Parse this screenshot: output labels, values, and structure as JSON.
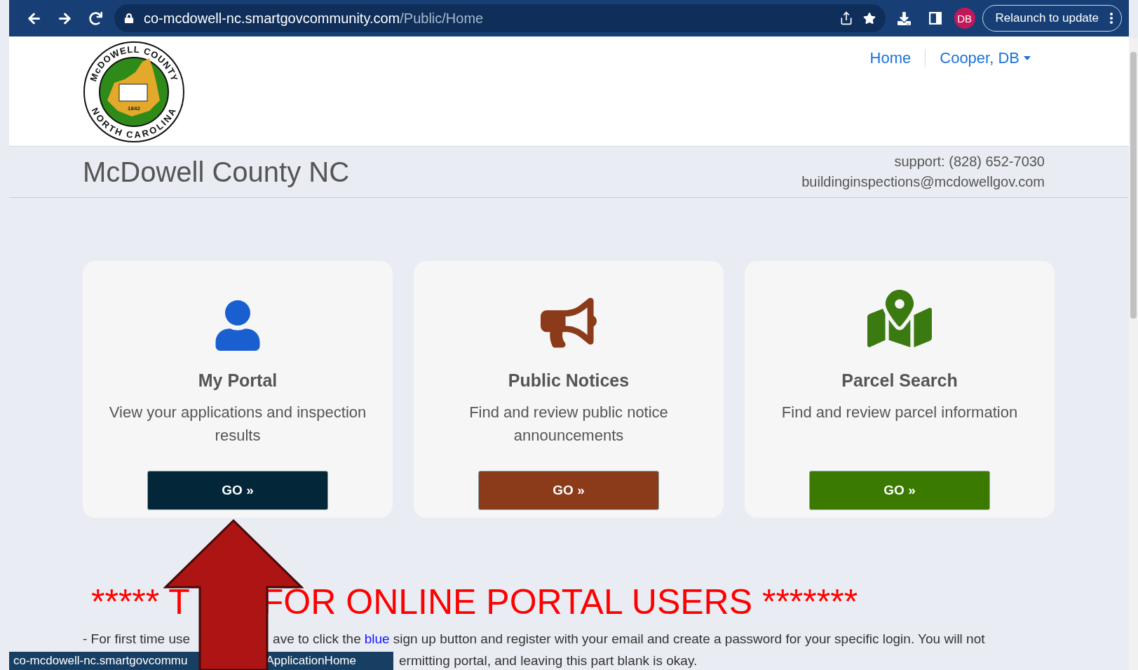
{
  "browser": {
    "url_host": "co-mcdowell-nc.smartgovcommunity.com",
    "url_path": "/Public/Home",
    "profile": "DB",
    "update_button": "Relaunch to update"
  },
  "logo": {
    "top": "McDOWELL COUNTY",
    "bottom": "NORTH CAROLINA",
    "year": "1842"
  },
  "nav": [
    {
      "label": "Home",
      "dropdown": false
    },
    {
      "label": "Cooper, DB",
      "dropdown": true
    }
  ],
  "site_title": "McDowell County NC",
  "support": [
    "support: (828) 652-7030",
    "buildinginspections@mcdowellgov.com"
  ],
  "cards": [
    {
      "kind": "person",
      "title": "My Portal",
      "description": "View your applications and inspection results",
      "button": "GO »",
      "color": "#032639"
    },
    {
      "kind": "megaphone",
      "title": "Public Notices",
      "description": "Find and review public notice announcements",
      "button": "GO »",
      "color": "#8b3a1a"
    },
    {
      "kind": "map",
      "title": "Parcel Search",
      "description": "Find and review parcel information",
      "button": "GO »",
      "color": "#3a7a00"
    }
  ],
  "notice": {
    "heading_left": "***** T",
    "heading_right": "FOR ONLINE PORTAL USERS *******",
    "line1_left": "- For first time use",
    "line1_before": "ave to click the",
    "line1_link": "blue",
    "line1_after": "sign up button and register with your email and create a password for your specific login.  You will not",
    "line2": "ermitting portal, and leaving this part blank is okay."
  },
  "status_link": [
    "co-mcdowell-nc.smartgovcommu",
    "ApplicationHome"
  ]
}
